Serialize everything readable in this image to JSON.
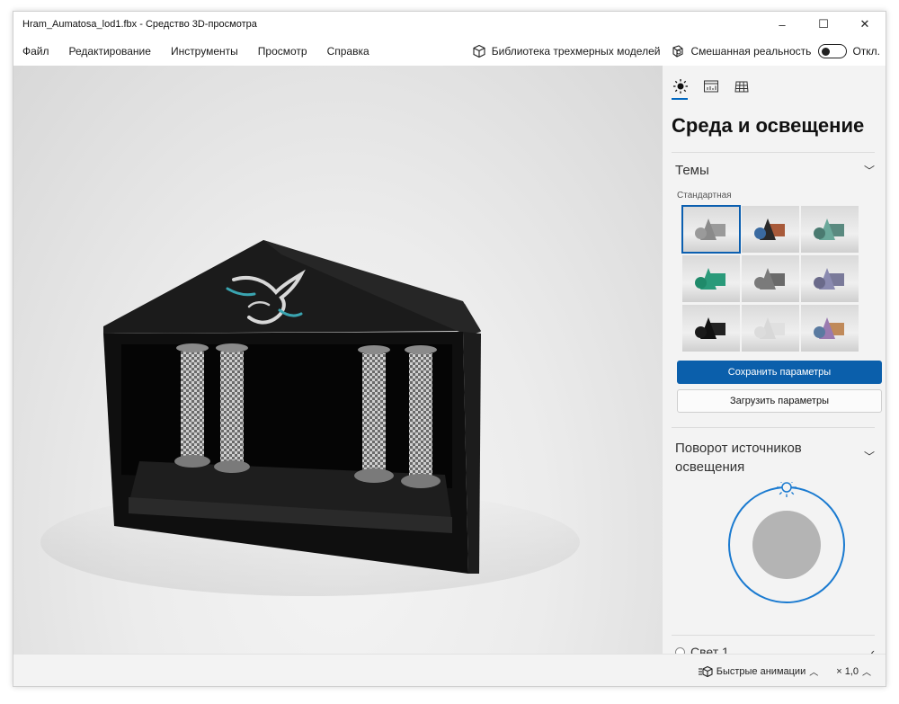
{
  "window": {
    "title": "Hram_Aumatosa_lod1.fbx - Средство 3D-просмотра",
    "minimize": "–",
    "maximize": "☐",
    "close": "✕"
  },
  "menu": {
    "items": [
      "Файл",
      "Редактирование",
      "Инструменты",
      "Просмотр",
      "Справка"
    ],
    "library": "Библиотека трехмерных моделей",
    "mixed_reality": "Смешанная реальность",
    "toggle_state": "Откл."
  },
  "panel": {
    "tabs": [
      "sun-icon",
      "stats-icon",
      "grid-icon"
    ],
    "title": "Среда и освещение",
    "themes": {
      "header": "Темы",
      "selected_label": "Стандартная",
      "tiles": [
        {
          "cone": "#8a8a8a",
          "box": "#9a9a9a",
          "ball": "#9a9a9a"
        },
        {
          "cone": "#2a2a2a",
          "box": "#a85a3a",
          "ball": "#3a6aa0"
        },
        {
          "cone": "#6aa89a",
          "box": "#5a8a80",
          "ball": "#4a7a70"
        },
        {
          "cone": "#2a9a7a",
          "box": "#2a9a7a",
          "ball": "#1f8a6a"
        },
        {
          "cone": "#7a7a7a",
          "box": "#6a6a6a",
          "ball": "#7a7a7a"
        },
        {
          "cone": "#8a8ab0",
          "box": "#7a7a9a",
          "ball": "#6a6a8a"
        },
        {
          "cone": "#111111",
          "box": "#222222",
          "ball": "#1a1a1a"
        },
        {
          "cone": "#d8d8d8",
          "box": "#e0e0e0",
          "ball": "#dcdcdc"
        },
        {
          "cone": "#9a7ab0",
          "box": "#c08a5a",
          "ball": "#5a7aa0"
        }
      ]
    },
    "save_button": "Сохранить параметры",
    "load_button": "Загрузить параметры",
    "light_rotation": {
      "header_line1": "Поворот источников",
      "header_line2": "освещения"
    },
    "light1": "Свет 1"
  },
  "status": {
    "animations": "Быстрые анимации",
    "zoom": "× 1,0"
  },
  "colors": {
    "accent": "#0067c0",
    "primary_button": "#0b5fab"
  }
}
